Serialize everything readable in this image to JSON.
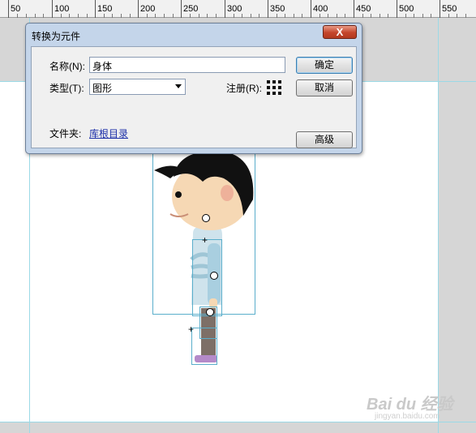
{
  "ruler": {
    "labels": [
      "50",
      "100",
      "150",
      "200",
      "250",
      "300",
      "350",
      "400",
      "450",
      "500",
      "550"
    ]
  },
  "dialog": {
    "title": "转换为元件",
    "close_label": "X",
    "name_label": "名称(N):",
    "name_value": "身体",
    "type_label": "类型(T):",
    "type_value": "图形",
    "register_label": "注册(R):",
    "folder_label": "文件夹:",
    "folder_link": "库根目录",
    "ok_label": "确定",
    "cancel_label": "取消",
    "advanced_label": "高级"
  },
  "watermark": {
    "brand": "Bai du 经验",
    "url": "jingyan.baidu.com"
  },
  "colors": {
    "stage": "#ffffff",
    "pasteboard": "#d6d6d6",
    "dialog_frame": "#c4d5ea",
    "guide": "#9bd9e6",
    "link": "#1b2ea8"
  }
}
